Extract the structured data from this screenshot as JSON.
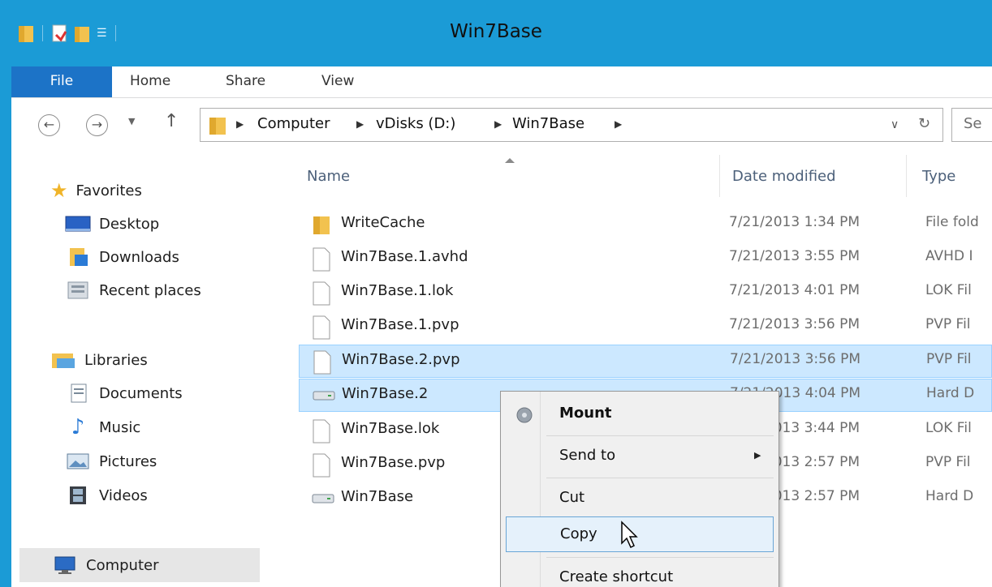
{
  "window": {
    "title": "Win7Base"
  },
  "ribbon": {
    "tabs": [
      "File",
      "Home",
      "Share",
      "View"
    ]
  },
  "address": {
    "crumbs": [
      "Computer",
      "vDisks (D:)",
      "Win7Base"
    ],
    "search_placeholder": "Se"
  },
  "nav": {
    "favorites": {
      "label": "Favorites",
      "items": [
        "Desktop",
        "Downloads",
        "Recent places"
      ]
    },
    "libraries": {
      "label": "Libraries",
      "items": [
        "Documents",
        "Music",
        "Pictures",
        "Videos"
      ]
    },
    "computer": "Computer"
  },
  "columns": {
    "name": "Name",
    "date": "Date modified",
    "type": "Type"
  },
  "files": [
    {
      "name": "WriteCache",
      "date": "7/21/2013 1:34 PM",
      "type": "File fold",
      "icon": "folder-icon"
    },
    {
      "name": "Win7Base.1.avhd",
      "date": "7/21/2013 3:55 PM",
      "type": "AVHD I",
      "icon": "file-icon"
    },
    {
      "name": "Win7Base.1.lok",
      "date": "7/21/2013 4:01 PM",
      "type": "LOK Fil",
      "icon": "file-icon"
    },
    {
      "name": "Win7Base.1.pvp",
      "date": "7/21/2013 3:56 PM",
      "type": "PVP Fil",
      "icon": "file-icon"
    },
    {
      "name": "Win7Base.2.pvp",
      "date": "7/21/2013 3:56 PM",
      "type": "PVP Fil",
      "icon": "file-icon",
      "selected": true
    },
    {
      "name": "Win7Base.2",
      "date": "7/21/2013 4:04 PM",
      "type": "Hard D",
      "icon": "hard-disk-icon",
      "selected": true
    },
    {
      "name": "Win7Base.lok",
      "date": "7/21/2013 3:44 PM",
      "type": "LOK Fil",
      "icon": "file-icon"
    },
    {
      "name": "Win7Base.pvp",
      "date": "7/21/2013 2:57 PM",
      "type": "PVP Fil",
      "icon": "file-icon"
    },
    {
      "name": "Win7Base",
      "date": "7/21/2013 2:57 PM",
      "type": "Hard D",
      "icon": "hard-disk-icon"
    }
  ],
  "context_menu": {
    "items": [
      "Mount",
      "Send to",
      "Cut",
      "Copy",
      "Create shortcut"
    ],
    "highlighted": "Copy"
  },
  "colors": {
    "titlebar": "#1b9bd6",
    "file_tab": "#1c73c7",
    "selection": "#cce8ff"
  }
}
